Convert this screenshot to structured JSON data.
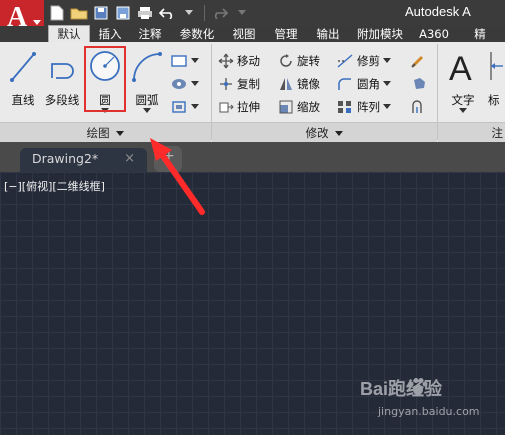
{
  "title_bar": {
    "app_title": "Autodesk A"
  },
  "tabs": [
    {
      "label": "默认"
    },
    {
      "label": "插入"
    },
    {
      "label": "注释"
    },
    {
      "label": "参数化"
    },
    {
      "label": "视图"
    },
    {
      "label": "管理"
    },
    {
      "label": "输出"
    },
    {
      "label": "附加模块"
    },
    {
      "label": "A360"
    },
    {
      "label": "精"
    }
  ],
  "draw_panel": {
    "line": "直线",
    "polyline": "多段线",
    "circle": "圆",
    "arc": "圆弧",
    "panel_label": "绘图"
  },
  "modify_panel": {
    "move": "移动",
    "rotate": "旋转",
    "trim": "修剪",
    "copy": "复制",
    "mirror": "镜像",
    "fillet": "圆角",
    "stretch": "拉伸",
    "scale": "缩放",
    "array": "阵列",
    "panel_label": "修改"
  },
  "annotation_panel": {
    "text": "文字",
    "dim": "标",
    "panel_label": "注"
  },
  "doc_tab": {
    "name": "Drawing2*",
    "close": "×"
  },
  "viewport_label": "[−][俯视][二维线框]",
  "watermark": {
    "brand": "Bai跑经验",
    "url": "jingyan.baidu.com"
  },
  "colors": {
    "app_red": "#c8262a",
    "highlight_red": "#e03030",
    "canvas_bg": "#242a37"
  }
}
